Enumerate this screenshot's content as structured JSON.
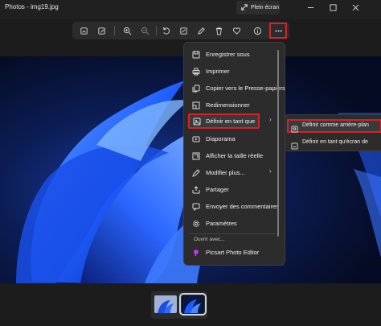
{
  "window": {
    "title": "Photos - img19.jpg",
    "fullscreen_label": "Plein écran"
  },
  "toolbar": {
    "buttons": [
      "crop-icon",
      "edit-image-icon",
      "zoom-in-icon",
      "zoom-out-icon",
      "rotate-icon",
      "markup-icon",
      "draw-icon",
      "delete-icon",
      "favorite-icon",
      "info-icon",
      "more-icon"
    ]
  },
  "menu": {
    "items": [
      {
        "label": "Enregistrer sous",
        "icon": "save-icon"
      },
      {
        "label": "Imprimer",
        "icon": "print-icon"
      },
      {
        "label": "Copier vers le Presse-papiers",
        "icon": "copy-icon"
      },
      {
        "label": "Redimensionner",
        "icon": "resize-icon"
      },
      {
        "label": "Définir en tant que",
        "icon": "set-as-icon",
        "submenu": true,
        "highlighted": true
      },
      {
        "label": "Diaporama",
        "icon": "slideshow-icon"
      },
      {
        "label": "Afficher la taille réelle",
        "icon": "actual-size-icon"
      },
      {
        "label": "Modifier plus...",
        "icon": "edit-more-icon",
        "submenu": true
      },
      {
        "label": "Partager",
        "icon": "share-icon"
      },
      {
        "label": "Envoyer des commentaires",
        "icon": "feedback-icon"
      },
      {
        "label": "Paramètres",
        "icon": "settings-icon"
      }
    ],
    "open_with_label": "Ouvrir avec...",
    "open_with_app": "Picsart Photo Editor"
  },
  "submenu": {
    "items": [
      {
        "label": "Définir comme arrière-plan",
        "icon": "wallpaper-icon",
        "highlighted": true
      },
      {
        "label": "Définir en tant qu'écran de",
        "icon": "lockscreen-icon"
      }
    ]
  },
  "colors": {
    "highlight_border": "#d3232b",
    "accent_blue": "#1e5cff"
  }
}
